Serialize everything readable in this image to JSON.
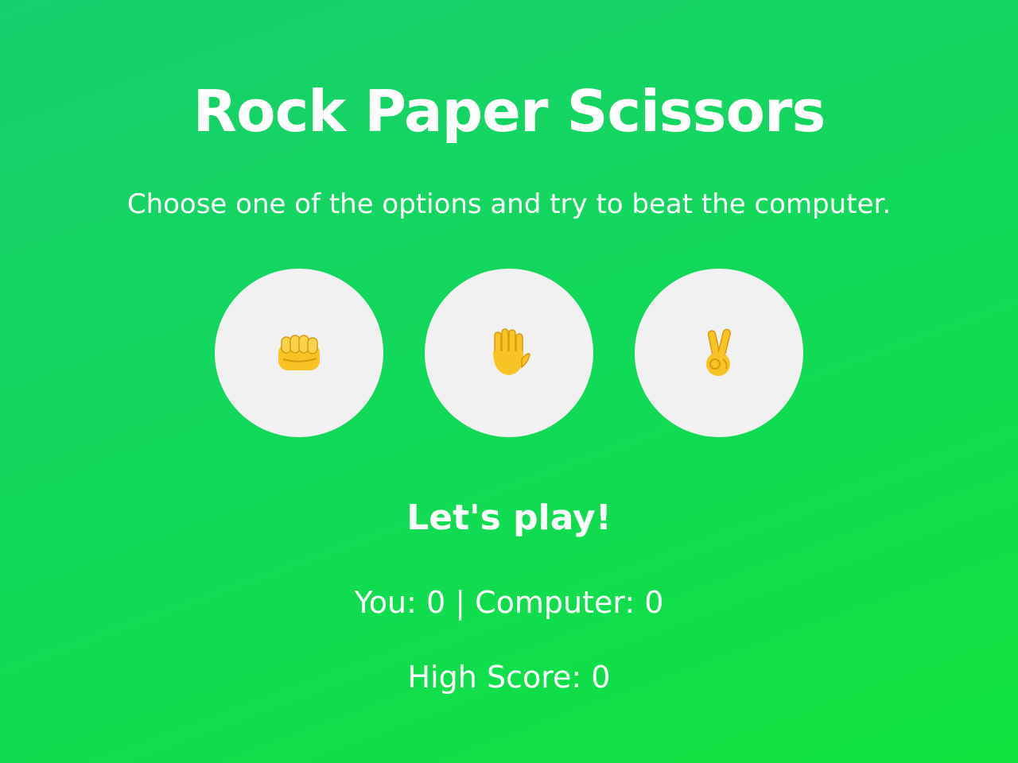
{
  "title": "Rock Paper Scissors",
  "subtitle": "Choose one of the options and try to beat the computer.",
  "choices": [
    {
      "name": "rock",
      "icon": "fist-icon",
      "emoji": "👊"
    },
    {
      "name": "paper",
      "icon": "raised-hand-icon",
      "emoji": "✋"
    },
    {
      "name": "scissors",
      "icon": "victory-hand-icon",
      "emoji": "✌"
    }
  ],
  "status": "Let's play!",
  "score": {
    "you_label": "You:",
    "you": "0",
    "separator": "|",
    "computer_label": "Computer:",
    "computer": "0"
  },
  "high_score": {
    "label": "High Score:",
    "value": "0"
  },
  "colors": {
    "background_start": "#17cf6e",
    "background_end": "#0fe23c",
    "button": "#f1f1f1",
    "emoji": "#f7c325",
    "text": "#ffffff"
  }
}
